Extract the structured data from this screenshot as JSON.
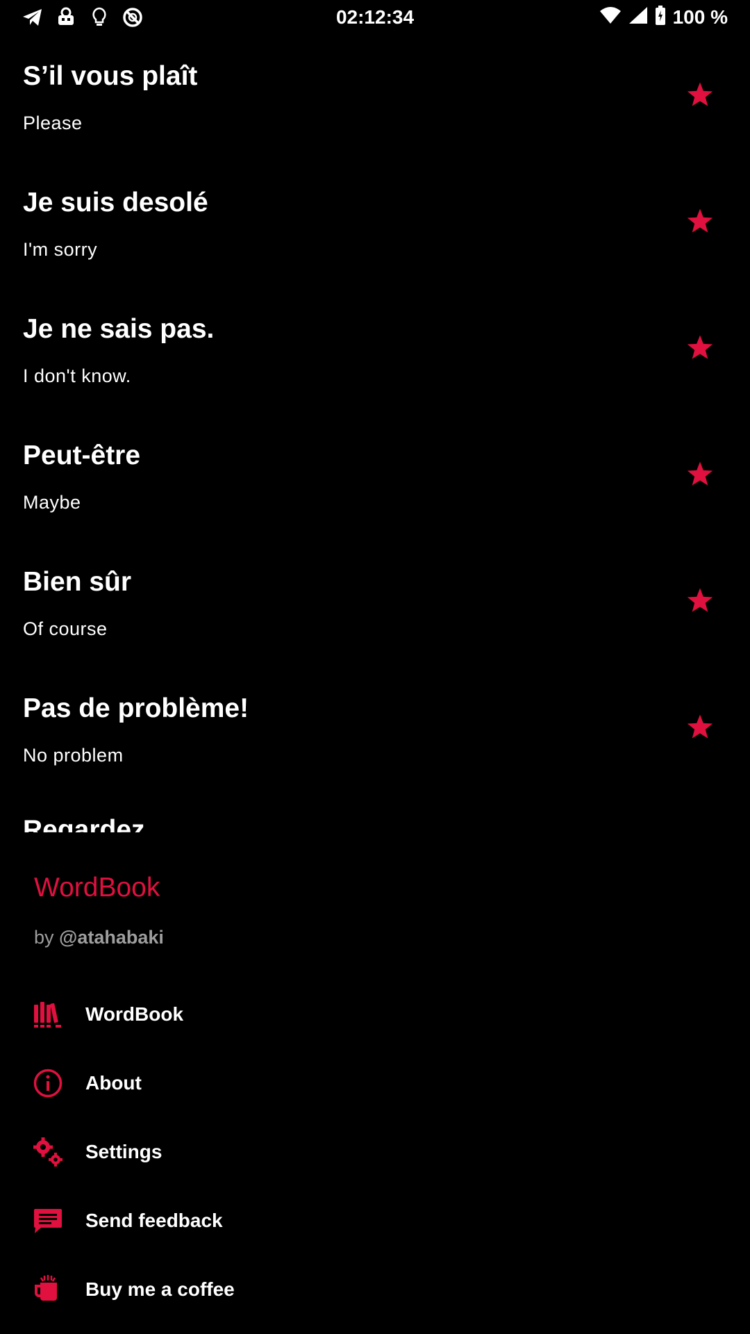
{
  "status_bar": {
    "time": "02:12:34",
    "battery": "100 %",
    "left_icons": [
      "telegram-icon",
      "robot-icon",
      "bulb-icon",
      "circle-slash-icon"
    ],
    "right_icons": [
      "wifi-icon",
      "signal-icon",
      "battery-charging-icon"
    ]
  },
  "words": [
    {
      "fr": "S’il vous plaît",
      "en": "Please"
    },
    {
      "fr": "Je suis desolé",
      "en": "I'm sorry"
    },
    {
      "fr": "Je ne sais pas.",
      "en": "I don't know."
    },
    {
      "fr": "Peut-être",
      "en": "Maybe"
    },
    {
      "fr": "Bien sûr",
      "en": "Of course"
    },
    {
      "fr": "Pas de problème!",
      "en": "No problem"
    }
  ],
  "partial_word": "Regardez",
  "drawer": {
    "title": "WordBook",
    "by_prefix": "by",
    "author": "@atahabaki",
    "menu": [
      {
        "label": "WordBook",
        "icon": "books-icon"
      },
      {
        "label": "About",
        "icon": "info-icon"
      },
      {
        "label": "Settings",
        "icon": "gears-icon"
      },
      {
        "label": "Send feedback",
        "icon": "feedback-icon"
      },
      {
        "label": "Buy me a coffee",
        "icon": "coffee-icon"
      }
    ]
  },
  "colors": {
    "accent": "#e0103f",
    "background": "#000000",
    "text": "#ffffff",
    "muted": "#9e9e9e"
  }
}
